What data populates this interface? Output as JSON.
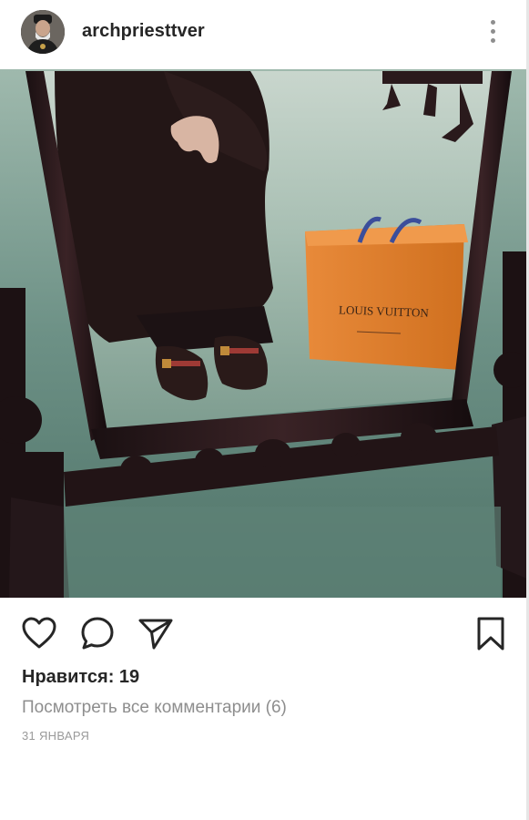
{
  "post": {
    "username": "archpriesttver",
    "likes_text": "Нравится: 19",
    "view_comments_text": "Посмотреть все комментарии (6)",
    "date_text": "31 ЯНВАРЯ"
  },
  "photo": {
    "bag_brand_text": "LOUIS VUITTON"
  },
  "icons": {
    "more": "more-vertical-icon",
    "like": "heart-icon",
    "comment": "comment-bubble-icon",
    "share": "paper-plane-icon",
    "save": "bookmark-icon"
  },
  "colors": {
    "text_primary": "#262626",
    "text_secondary": "#8e8e8e",
    "background": "#ffffff"
  }
}
